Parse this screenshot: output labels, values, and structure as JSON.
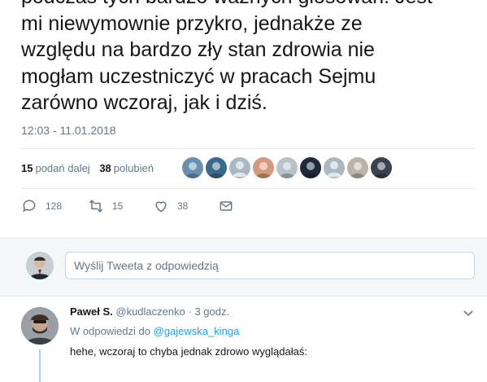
{
  "tweet": {
    "lines": [
      "podczas tych bardzo ważnych głosowań. Jest",
      "mi niewymownie przykro, jednakże ze",
      "względu na bardzo zły stan zdrowia nie",
      "mogłam uczestniczyć w pracach Sejmu",
      "zarówno wczoraj, jak i dziś."
    ],
    "timestamp": "12:03 - 11.01.2018"
  },
  "stats": {
    "retweets_count": "15",
    "retweets_label": "podań dalej",
    "likes_count": "38",
    "likes_label": "polubień"
  },
  "avatars": [
    {
      "icon": "avatar-boat",
      "color": "#6a8fb0"
    },
    {
      "icon": "avatar-man-glasses",
      "color": "#3a6a8a"
    },
    {
      "icon": "avatar-default",
      "color": "#aab8c2"
    },
    {
      "icon": "avatar-woman",
      "color": "#d49a7a"
    },
    {
      "icon": "avatar-emblem",
      "color": "#b8c2c8"
    },
    {
      "icon": "avatar-crown",
      "color": "#1f2b3a"
    },
    {
      "icon": "avatar-default",
      "color": "#aab8c2"
    },
    {
      "icon": "avatar-woman-2",
      "color": "#b9b3a8"
    },
    {
      "icon": "avatar-man-suit",
      "color": "#39424d"
    }
  ],
  "actions": {
    "reply_count": "128",
    "retweet_count": "15",
    "like_count": "38"
  },
  "reply_box": {
    "placeholder": "Wyślij Tweeta z odpowiedzią"
  },
  "reply": {
    "name": "Paweł S.",
    "handle": "@kudlaczenko",
    "separator": "·",
    "time": "3 godz.",
    "in_reply_label": "W odpowiedzi do",
    "in_reply_handle": "@gajewska_kinga",
    "text": "hehe, wczoraj to chyba jednak zdrowo wyglądałaś:"
  },
  "colors": {
    "accent": "#1da1f2",
    "muted": "#657786",
    "text": "#14171a",
    "thread_line": "#a6d4f2"
  }
}
